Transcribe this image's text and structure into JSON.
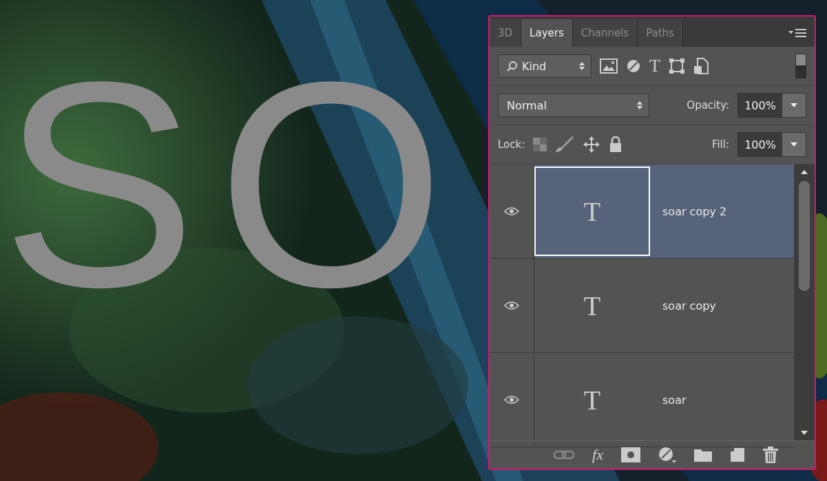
{
  "canvas": {
    "text": "SO"
  },
  "panel": {
    "tabs": [
      {
        "label": "3D",
        "selected": false
      },
      {
        "label": "Layers",
        "selected": true
      },
      {
        "label": "Channels",
        "selected": false
      },
      {
        "label": "Paths",
        "selected": false
      }
    ],
    "filter": {
      "value": "Kind",
      "type_glyph": "T"
    },
    "blend_mode": {
      "value": "Normal"
    },
    "opacity": {
      "label": "Opacity:",
      "value": "100%"
    },
    "lock": {
      "label": "Lock:"
    },
    "fill": {
      "label": "Fill:",
      "value": "100%"
    },
    "layers": [
      {
        "name": "soar copy 2",
        "glyph": "T",
        "visible": true,
        "selected": true
      },
      {
        "name": "soar copy",
        "glyph": "T",
        "visible": true,
        "selected": false
      },
      {
        "name": "soar",
        "glyph": "T",
        "visible": true,
        "selected": false
      }
    ],
    "footer": {
      "fx": "fx"
    }
  }
}
